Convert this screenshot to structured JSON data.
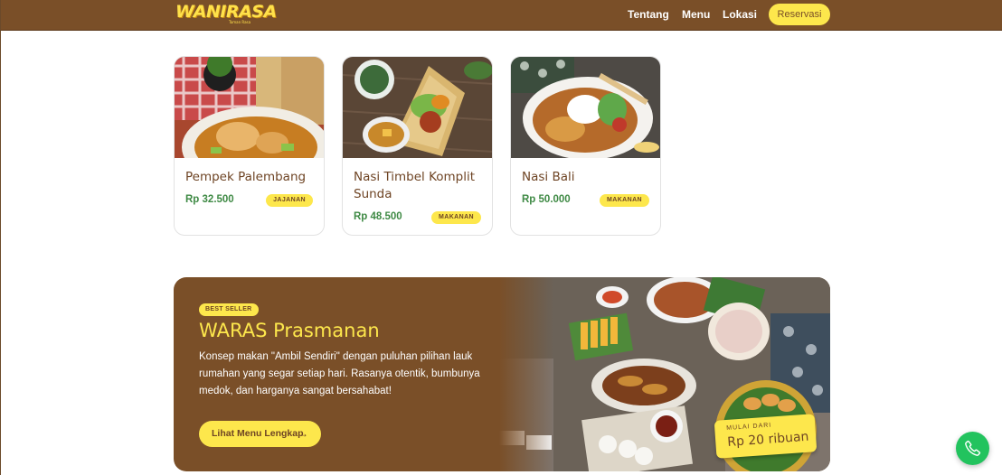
{
  "header": {
    "logo_text": "WANIRASA",
    "logo_tagline": "Taman Rasa",
    "nav": [
      "Tentang",
      "Menu",
      "Lokasi"
    ],
    "cta_label": "Reservasi"
  },
  "menu_cards": [
    {
      "name": "Pempek Palembang",
      "price": "Rp 32.500",
      "category": "JAJANAN"
    },
    {
      "name": "Nasi Timbel Komplit Sunda",
      "price": "Rp 48.500",
      "category": "MAKANAN"
    },
    {
      "name": "Nasi Bali",
      "price": "Rp 50.000",
      "category": "MAKANAN"
    }
  ],
  "promo": {
    "badge": "BEST SELLER",
    "title": "WARAS Prasmanan",
    "description": "Konsep makan \"Ambil Sendiri\" dengan puluhan pilihan lauk rumahan yang segar setiap hari. Rasanya otentik, bumbunya medok, dan harganya sangat bersahabat!",
    "button_label": "Lihat Menu Lengkap",
    "button_icon": "arrow-right-icon",
    "price_prefix": "MULAI DARI",
    "price_value": "Rp 20 ribuan"
  },
  "fab": {
    "icon": "phone-icon"
  },
  "colors": {
    "brand_brown": "#7a4f28",
    "accent_yellow": "#fde74c",
    "price_green": "#3f8a45",
    "whatsapp_green": "#22c35e"
  }
}
